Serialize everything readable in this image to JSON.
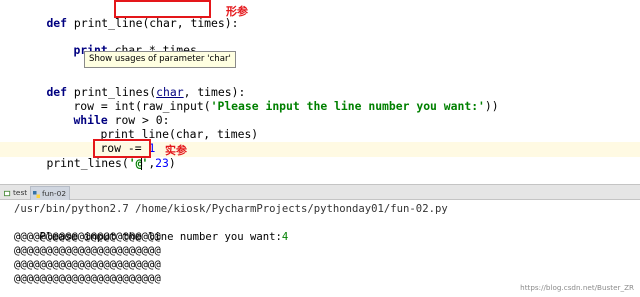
{
  "editor": {
    "lines": {
      "l1": {
        "kw": "def",
        "fn": " print_line",
        "paren": "(char, times):"
      },
      "l2": {
        "kw": "print",
        "rest": " char * times"
      },
      "l3": {
        "kw": "def",
        "fn": " print_lines(",
        "arg": "char",
        "rest": ", times):"
      },
      "l4": {
        "pre": "row = ",
        "fn": "int",
        "mid": "(raw_input(",
        "str": "'Please input the line number you want:'",
        "post": "))"
      },
      "l5": {
        "kw": "while",
        "rest": " row > 0:"
      },
      "l6": {
        "text": "print_line(char, times)"
      },
      "l7": {
        "pre": "row -= ",
        "num": "1"
      },
      "l8": {
        "pre": "print_lines(",
        "str1": "'@",
        "str2": "'",
        "comma": ",",
        "num": "23",
        "post": ")"
      }
    },
    "tooltip": "Show usages of parameter 'char'",
    "annotations": {
      "formal": "形参",
      "actual": "实参"
    }
  },
  "run": {
    "tabs": [
      {
        "label": "test"
      },
      {
        "label": "fun-02"
      }
    ],
    "console": {
      "command": "/usr/bin/python2.7 /home/kiosk/PycharmProjects/pythonday01/fun-02.py",
      "prompt": "Please input the line number you want:",
      "input": "4",
      "output": [
        "@@@@@@@@@@@@@@@@@@@@@@@",
        "@@@@@@@@@@@@@@@@@@@@@@@",
        "@@@@@@@@@@@@@@@@@@@@@@@",
        "@@@@@@@@@@@@@@@@@@@@@@@"
      ]
    }
  },
  "watermark": "https://blog.csdn.net/Buster_ZR",
  "colors": {
    "keyword": "#000080",
    "string": "#008000",
    "number": "#0000ff",
    "highlight": "#e4161a"
  }
}
